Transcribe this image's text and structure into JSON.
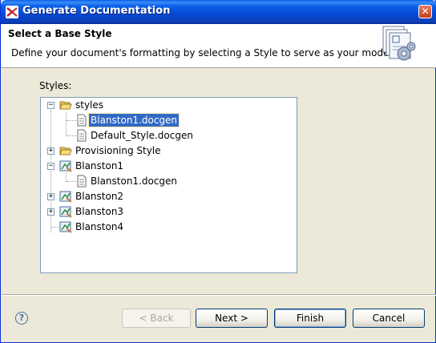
{
  "window": {
    "title": "Generate Documentation",
    "close_glyph": "✕"
  },
  "header": {
    "title": "Select a Base Style",
    "description": "Define your document's formatting by selecting a Style to serve as your model."
  },
  "styles_label": "Styles:",
  "tree": {
    "items": [
      {
        "label": "styles",
        "icon": "folder-open-icon",
        "expander": "−"
      },
      {
        "label": "Blanston1.docgen",
        "icon": "document-icon",
        "selected": true
      },
      {
        "label": "Default_Style.docgen",
        "icon": "document-icon"
      },
      {
        "label": "Provisioning Style",
        "icon": "folder-open-icon",
        "expander": "+"
      },
      {
        "label": "Blanston1",
        "icon": "project-icon",
        "expander": "−"
      },
      {
        "label": "Blanston1.docgen",
        "icon": "document-icon"
      },
      {
        "label": "Blanston2",
        "icon": "project-icon",
        "expander": "+"
      },
      {
        "label": "Blanston3",
        "icon": "project-icon",
        "expander": "+"
      },
      {
        "label": "Blanston4",
        "icon": "project-icon"
      }
    ]
  },
  "buttons": {
    "help": "?",
    "back": "< Back",
    "next": "Next >",
    "finish": "Finish",
    "cancel": "Cancel"
  },
  "colors": {
    "selection": "#316AC5",
    "titlebar": "#0A5FE8"
  }
}
